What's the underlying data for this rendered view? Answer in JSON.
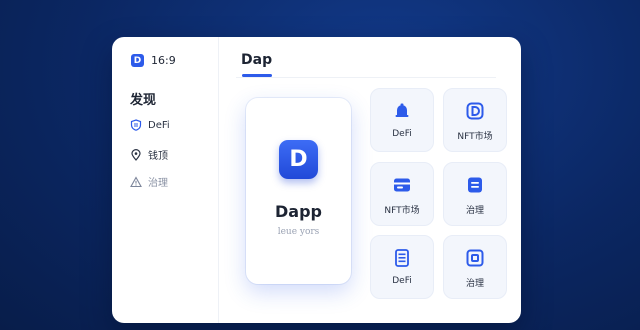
{
  "sidebar": {
    "brand_logo": "D",
    "brand_text": "16:9",
    "section_title": "发现",
    "items": [
      {
        "label": "DeFi",
        "icon": "shield-icon"
      },
      {
        "label": "钱顶",
        "icon": "location-pin-icon"
      },
      {
        "label": "治理",
        "icon": "warning-triangle-icon"
      }
    ]
  },
  "main": {
    "title": "Dap",
    "featured": {
      "logo_letter": "D",
      "name": "Dapp",
      "subtitle": "leue yors"
    },
    "tiles": [
      {
        "label": "DeFi",
        "icon": "bell-icon"
      },
      {
        "label": "NFT市场",
        "icon": "d-badge-icon"
      },
      {
        "label": "NFT市场",
        "icon": "wallet-icon"
      },
      {
        "label": "治理",
        "icon": "card-list-icon"
      },
      {
        "label": "DeFi",
        "icon": "document-lines-icon"
      },
      {
        "label": "治理",
        "icon": "square-frame-icon"
      }
    ]
  },
  "colors": {
    "accent": "#2d5bea",
    "background": "#0b2763",
    "tile_background": "#f3f6fc"
  }
}
